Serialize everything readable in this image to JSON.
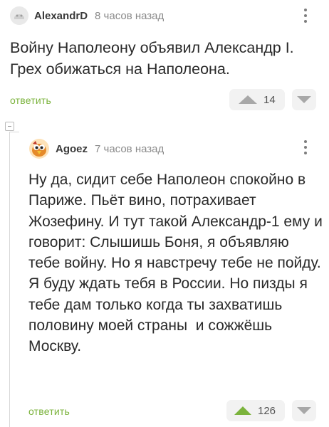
{
  "comments": [
    {
      "author": "AlexandrD",
      "time": "8 часов назад",
      "text": "Войну Наполеону объявил Александр I. Грех обижаться на Наполеона.",
      "reply_label": "ответить",
      "score": "14",
      "avatar_icon": "avatar-placeholder-icon"
    },
    {
      "author": "Agoez",
      "time": "7 часов назад",
      "text": "Ну да, сидит себе Наполеон спокойно в Париже. Пьёт вино, потрахивает Жозефину. И тут такой Александр-1 ему и говорит: Слышишь Боня, я объявляю тебе войну. Но я навстречу тебе не пойду. Я буду ждать тебя в России. Но пизды я тебе дам только когда ты захватишь половину моей страны  и сожжёшь Москву.",
      "reply_label": "ответить",
      "score": "126",
      "avatar_icon": "bird-avatar-icon"
    }
  ],
  "colors": {
    "accent_green": "#7bb33c",
    "muted_arrow": "#a8a8a8"
  }
}
